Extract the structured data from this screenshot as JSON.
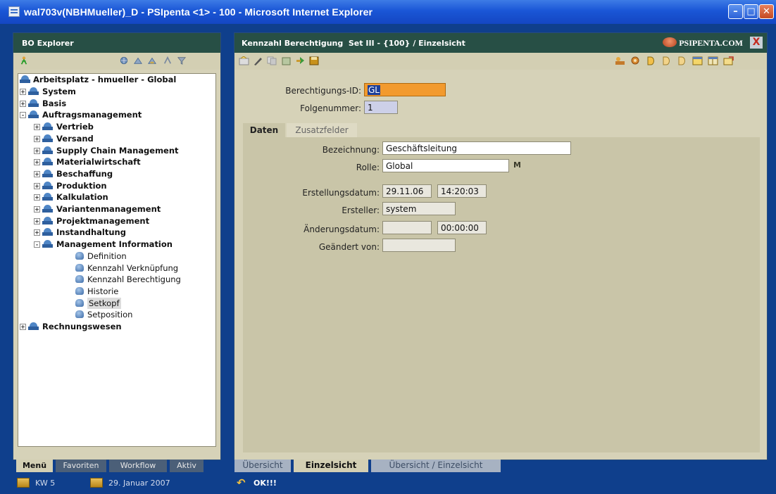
{
  "window": {
    "title": "wal703v(NBHMueller)_D - PSIpenta <1> - 100 - Microsoft Internet Explorer"
  },
  "left": {
    "header": "BO Explorer",
    "tree_root": "Arbeitsplatz - hmueller - Global",
    "tree": [
      {
        "label": "System",
        "level": 1,
        "expander": "+",
        "bold": true
      },
      {
        "label": "Basis",
        "level": 1,
        "expander": "+",
        "bold": true
      },
      {
        "label": "Auftragsmanagement",
        "level": 1,
        "expander": "-",
        "bold": true
      },
      {
        "label": "Vertrieb",
        "level": 2,
        "expander": "+",
        "bold": true
      },
      {
        "label": "Versand",
        "level": 2,
        "expander": "+",
        "bold": true
      },
      {
        "label": "Supply Chain Management",
        "level": 2,
        "expander": "+",
        "bold": true
      },
      {
        "label": "Materialwirtschaft",
        "level": 2,
        "expander": "+",
        "bold": true
      },
      {
        "label": "Beschaffung",
        "level": 2,
        "expander": "+",
        "bold": true
      },
      {
        "label": "Produktion",
        "level": 2,
        "expander": "+",
        "bold": true
      },
      {
        "label": "Kalkulation",
        "level": 2,
        "expander": "+",
        "bold": true
      },
      {
        "label": "Variantenmanagement",
        "level": 2,
        "expander": "+",
        "bold": true
      },
      {
        "label": "Projektmanagement",
        "level": 2,
        "expander": "+",
        "bold": true
      },
      {
        "label": "Instandhaltung",
        "level": 2,
        "expander": "+",
        "bold": true
      },
      {
        "label": "Management Information",
        "level": 2,
        "expander": "-",
        "bold": true
      },
      {
        "label": "Definition",
        "level": 3,
        "expander": "",
        "bold": false
      },
      {
        "label": "Kennzahl Verknüpfung",
        "level": 3,
        "expander": "",
        "bold": false
      },
      {
        "label": "Kennzahl Berechtigung",
        "level": 3,
        "expander": "",
        "bold": false
      },
      {
        "label": "Historie",
        "level": 3,
        "expander": "",
        "bold": false
      },
      {
        "label": "Setkopf",
        "level": 3,
        "expander": "",
        "bold": false,
        "selected": true
      },
      {
        "label": "Setposition",
        "level": 3,
        "expander": "",
        "bold": false
      },
      {
        "label": "Rechnungswesen",
        "level": 1,
        "expander": "+",
        "bold": true
      }
    ],
    "bottom_tabs": [
      "Menü",
      "Favoriten",
      "Workflow",
      "Aktiv"
    ],
    "active_bottom_tab": "Menü",
    "status_week": "KW 5",
    "status_date": "29. Januar 2007"
  },
  "right": {
    "header": "Kennzahl Berechtigung  Set III - {100} / Einzelsicht",
    "brand": "PSIPENTA.COM",
    "close_glyph": "X",
    "berechtigungs_id_label": "Berechtigungs-ID:",
    "berechtigungs_id_value": "GL",
    "folgenummer_label": "Folgenummer:",
    "folgenummer_value": "1",
    "tabs": [
      "Daten",
      "Zusatzfelder"
    ],
    "active_tab": "Daten",
    "bezeichnung_label": "Bezeichnung:",
    "bezeichnung_value": "Geschäftsleitung",
    "rolle_label": "Rolle:",
    "rolle_value": "Global",
    "rolle_lookup_glyph": "M",
    "erstellungsdatum_label": "Erstellungsdatum:",
    "erstellungsdatum_date": "29.11.06",
    "erstellungsdatum_time": "14:20:03",
    "ersteller_label": "Ersteller:",
    "ersteller_value": "system",
    "aenderungsdatum_label": "Änderungsdatum:",
    "aenderungsdatum_date": "",
    "aenderungsdatum_time": "00:00:00",
    "geaendert_von_label": "Geändert von:",
    "geaendert_von_value": "",
    "bottom_tabs": [
      "Übersicht",
      "Einzelsicht",
      "Übersicht / Einzelsicht"
    ],
    "active_bottom_tab": "Einzelsicht",
    "status": "OK!!!"
  },
  "colors": {
    "title_blue": "#1a56d6",
    "panel_header": "#274f45",
    "panel_bg": "#d6d2b8",
    "form_bg": "#c9c5a8",
    "id_field": "#f29a2e",
    "folge_field": "#cdd0e8",
    "outer_blue": "#0f3f8c"
  }
}
